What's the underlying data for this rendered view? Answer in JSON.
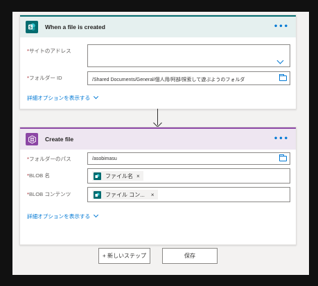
{
  "trigger": {
    "title": "When a file is created",
    "more": "•••",
    "fields": [
      {
        "label": "サイトのアドレス",
        "value": ""
      },
      {
        "label": "フォルダー ID",
        "value": "/Shared Documents/General/個人用/阿部/探索して遊ぶようのフォルダ"
      }
    ],
    "advanced": "詳細オプションを表示する"
  },
  "action": {
    "title": "Create file",
    "more": "•••",
    "fields": [
      {
        "label": "フォルダーのパス",
        "value": "/asobimasu"
      },
      {
        "label": "BLOB 名",
        "token": "ファイル名",
        "token_close": "×"
      },
      {
        "label": "BLOB コンテンツ",
        "token": "ファイル コン...",
        "token_close": "×"
      }
    ],
    "advanced": "詳細オプションを表示する"
  },
  "buttons": {
    "new_step": "+ 新しいステップ",
    "save": "保存"
  },
  "required_mark": "*",
  "colors": {
    "sharepoint": "#036c70",
    "blob": "#8c46a5",
    "accent": "#0078d4",
    "required": "#a4262c"
  }
}
